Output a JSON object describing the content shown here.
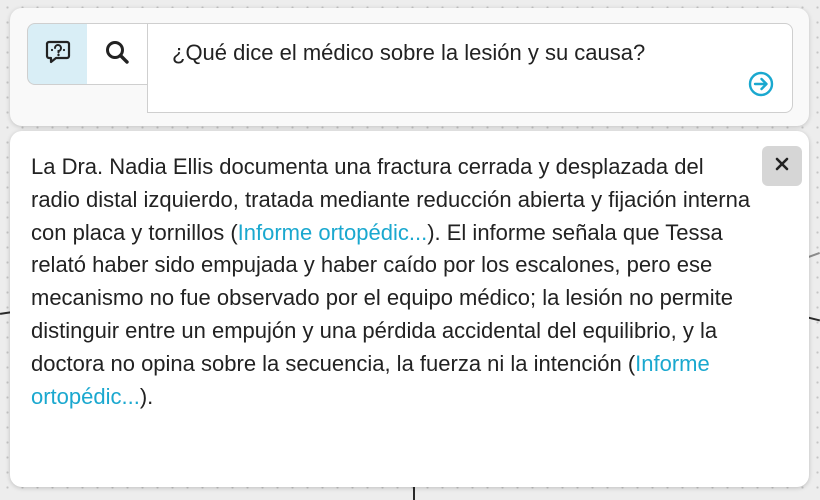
{
  "search": {
    "modes": [
      {
        "name": "ask",
        "icon": "chat-question-icon",
        "active": true
      },
      {
        "name": "search",
        "icon": "search-icon",
        "active": false
      }
    ],
    "query": "¿Qué dice el médico sobre la lesión y su causa?",
    "submit_icon": "arrow-right-circle-icon"
  },
  "answer": {
    "close_label": "×",
    "segments": {
      "s1": "La Dra. Nadia Ellis documenta una fractura cerrada y desplazada del radio distal izquierdo, tratada mediante reducción abierta y fijación interna con placa y tornillos (",
      "cite1": "Informe ortopédic...",
      "s2": "). El informe señala que Tessa relató haber sido empujada y haber caído por los escalones, pero ese mecanismo no fue observado por el equipo médico; la lesión no permite distinguir entre un empujón y una pérdida accidental del equilibrio, y la doctora no opina sobre la secuencia, la fuerza ni la intención (",
      "cite2": "Informe ortopédic...",
      "s3": ")."
    }
  },
  "colors": {
    "accent": "#1aa8cf",
    "active_mode_bg": "#d9eef6",
    "close_button_bg": "#d6d6d6"
  }
}
